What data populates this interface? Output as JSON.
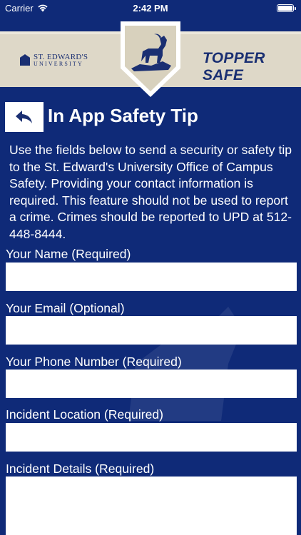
{
  "status_bar": {
    "carrier": "Carrier",
    "time": "2:42 PM"
  },
  "header": {
    "university_line1": "ST. EDWARD'S",
    "university_line2": "UNIVERSITY",
    "app_brand": "TOPPER SAFE"
  },
  "page": {
    "title": "In App Safety Tip",
    "intro": "Use the fields below to send a security or safety tip to the St. Edward's University Office of Campus Safety. Providing your contact information is required. This feature should not be used to report a crime. Crimes should be reported to UPD at 512-448-8444."
  },
  "form": {
    "name_label": "Your Name (Required)",
    "email_label": "Your Email (Optional)",
    "phone_label": "Your Phone Number (Required)",
    "location_label": "Incident Location (Required)",
    "details_label": "Incident Details (Required)",
    "name_value": "",
    "email_value": "",
    "phone_value": "",
    "location_value": "",
    "details_value": ""
  },
  "colors": {
    "background": "#0f2a78",
    "header_band": "#ded8c8",
    "brand_navy": "#1a2f72"
  }
}
